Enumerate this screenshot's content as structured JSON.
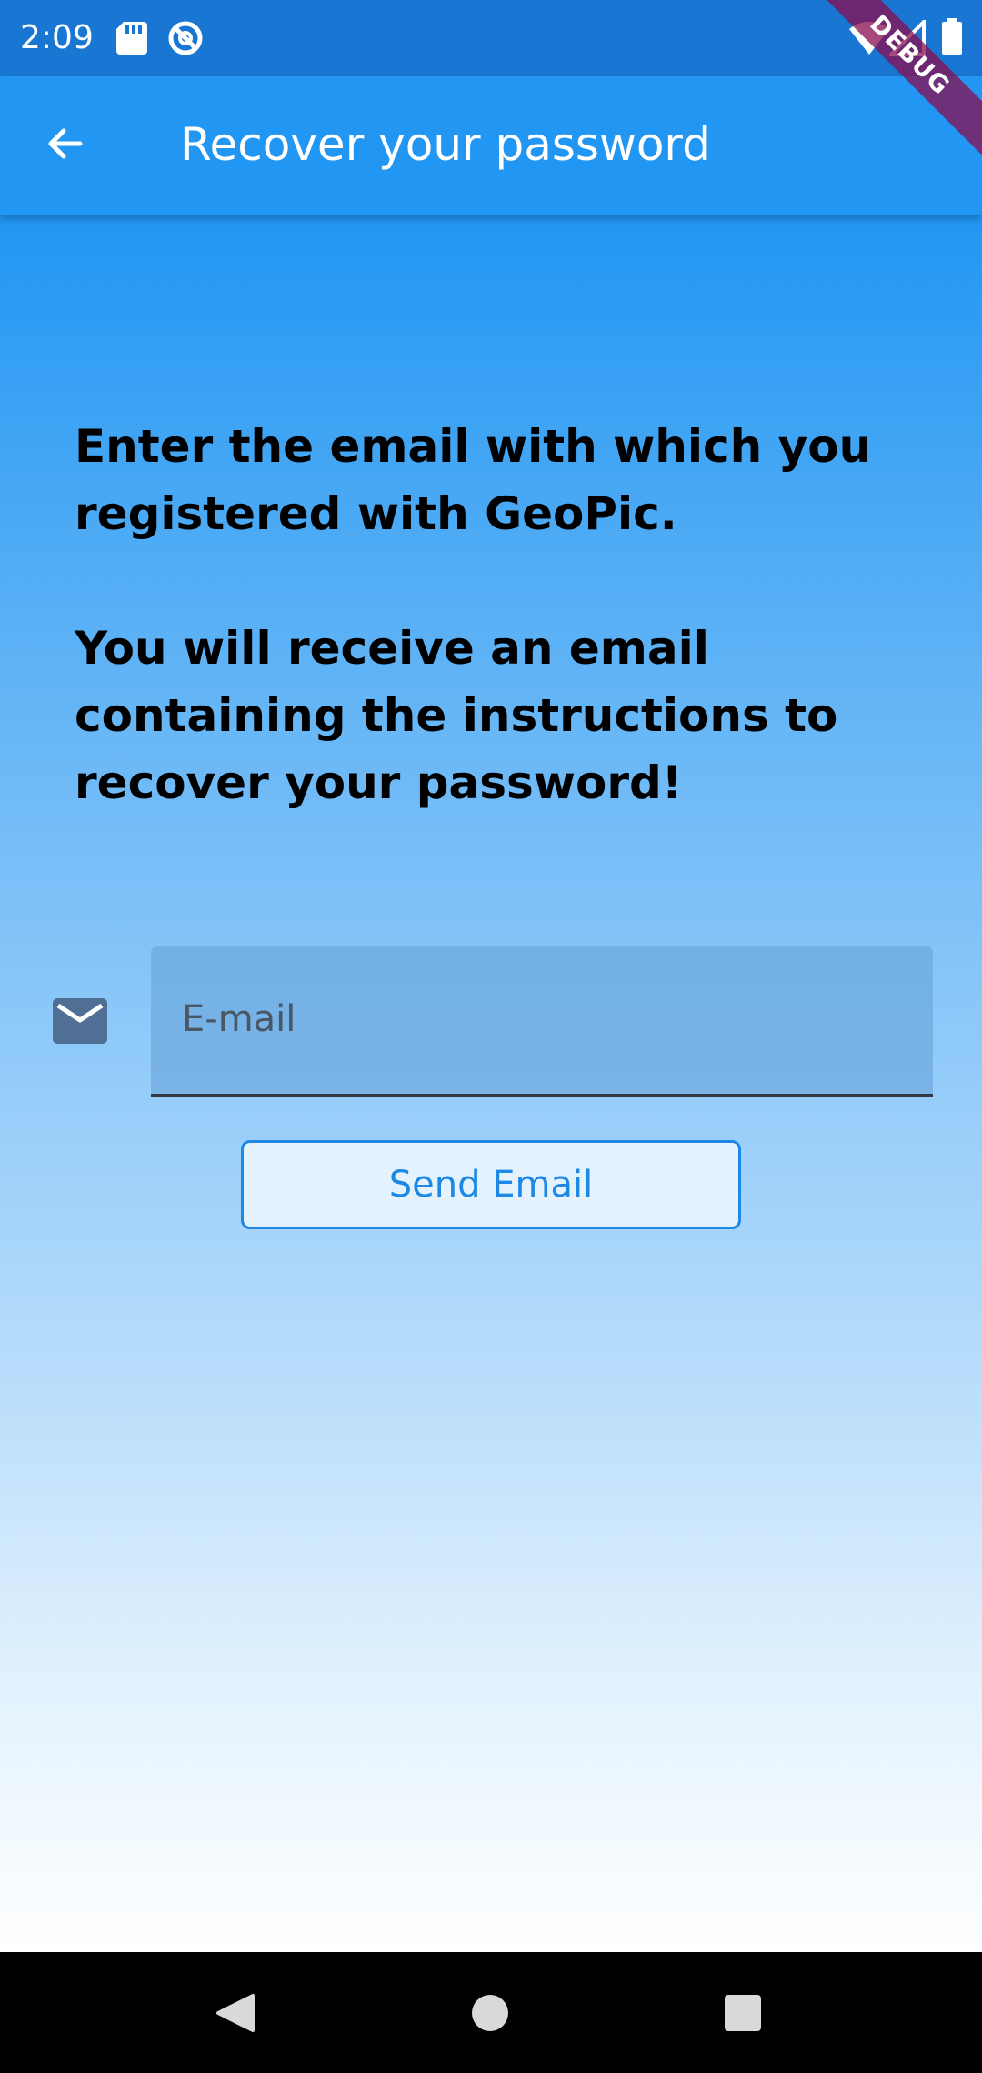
{
  "status_bar": {
    "time": "2:09",
    "icons": [
      "sd-card-icon",
      "sync-icon",
      "wifi-icon",
      "signal-icon",
      "battery-icon"
    ]
  },
  "app_bar": {
    "title": "Recover your password",
    "back_icon": "arrow-left-icon"
  },
  "debug_banner": "DEBUG",
  "main": {
    "instructions": "Enter the email with which you registered with GeoPic.\n\nYou will receive an email containing the instructions to recover your password!",
    "email_field": {
      "icon": "mail-icon",
      "placeholder": "E-mail",
      "value": ""
    },
    "send_button_label": "Send Email"
  },
  "nav_bar": {
    "icons": [
      "nav-back-icon",
      "nav-home-icon",
      "nav-recent-icon"
    ]
  },
  "colors": {
    "status_bar": "#1976d2",
    "app_bar": "#2196f3",
    "accent": "#1e88e5"
  }
}
